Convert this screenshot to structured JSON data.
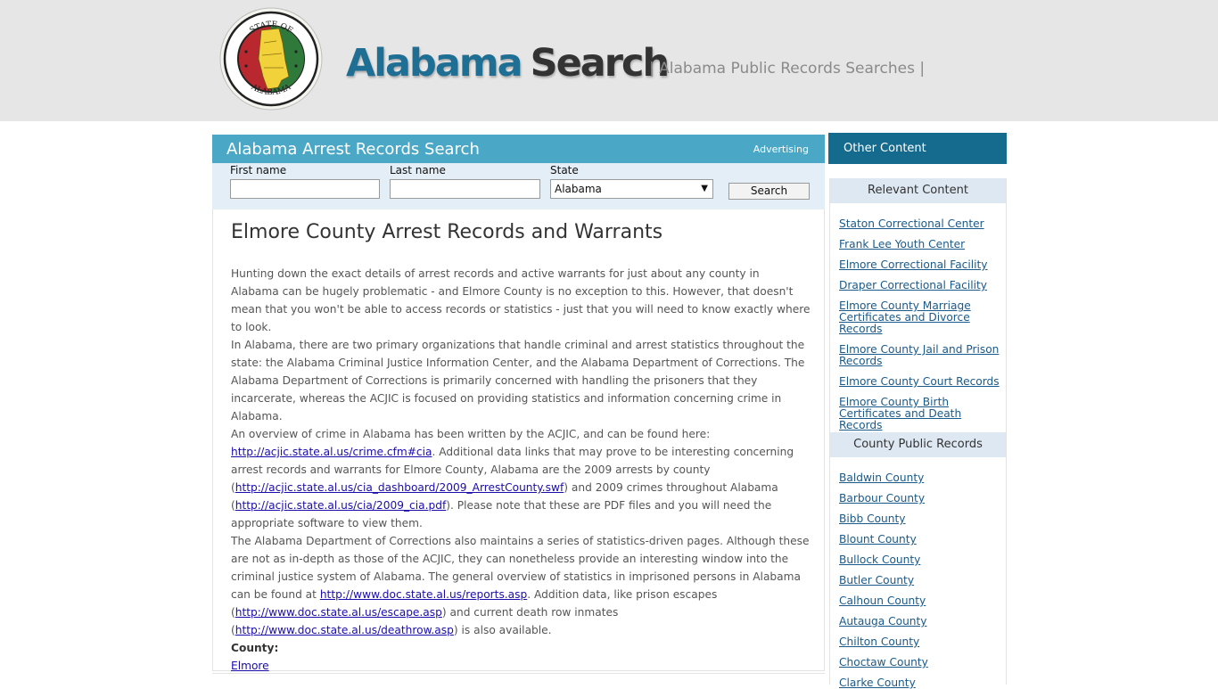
{
  "header": {
    "brand_part1": "Alabama",
    "brand_part2": "Search",
    "tagline": "| Alabama Public Records Searches |",
    "seal_top_text": "STATE OF",
    "seal_bottom_text": "ALABAMA"
  },
  "search": {
    "title": "Alabama Arrest Records Search",
    "advertising": "Advertising",
    "first_name_label": "First name",
    "first_name_value": "",
    "last_name_label": "Last name",
    "last_name_value": "",
    "state_label": "State",
    "state_value": "Alabama",
    "button_label": "Search"
  },
  "article": {
    "title": "Elmore County Arrest Records and Warrants",
    "p1": "Hunting down the exact details of arrest records and active warrants for just about any county in Alabama can be hugely problematic - and Elmore County is no exception to this. However, that doesn't mean that you won't be able to access records or statistics - just that you will need to know exactly where to look.",
    "p2": "In Alabama, there are two primary organizations that handle criminal and arrest statistics throughout the state: the Alabama Criminal Justice Information Center, and the Alabama Department of Corrections. The Alabama Department of Corrections is primarily concerned with handling the prisoners that they incarcerate, whereas the ACJIC is focused on providing statistics and information concerning crime in Alabama.",
    "p3_a": "An overview of crime in Alabama has been written by the ACJIC, and can be found here: ",
    "p3_link1": "http://acjic.state.al.us/crime.cfm#cia",
    "p3_b": ". Additional data links that may prove to be interesting concerning arrest records and warrants for Elmore County, Alabama are the 2009 arrests by county (",
    "p3_link2": "http://acjic.state.al.us/cia_dashboard/2009_ArrestCounty.swf",
    "p3_c": ") and 2009 crimes throughout Alabama (",
    "p3_link3": "http://acjic.state.al.us/cia/2009_cia.pdf",
    "p3_d": "). Please note that these are PDF files and you will need the appropriate software to view them.",
    "p4_a": "The Alabama Department of Corrections also maintains a series of statistics-driven pages. Although these are not as in-depth as those of the ACJIC, they can nonetheless provide an interesting window into the criminal justice system of Alabama. The general overview of statistics in imprisoned persons in Alabama can be found at ",
    "p4_link1": "http://www.doc.state.al.us/reports.asp",
    "p4_b": ". Addition data, like prison escapes (",
    "p4_link2": "http://www.doc.state.al.us/escape.asp",
    "p4_c": ") and current death row inmates (",
    "p4_link3": "http://www.doc.state.al.us/deathrow.asp",
    "p4_d": ") is also available.",
    "county_label": "County:",
    "county_link": "Elmore"
  },
  "sidebar": {
    "header": "Other Content",
    "relevant_title": "Relevant Content",
    "relevant_items": [
      "Staton Correctional Center",
      "Frank Lee Youth Center",
      "Elmore Correctional Facility",
      "Draper Correctional Facility",
      "Elmore County Marriage Certificates and Divorce Records",
      "Elmore County Jail and Prison Records",
      "Elmore County Court Records",
      "Elmore County Birth Certificates and Death Records"
    ],
    "county_title": "County Public Records",
    "county_items": [
      "Baldwin County",
      "Barbour County",
      "Bibb County",
      "Blount County",
      "Bullock County",
      "Butler County",
      "Calhoun County",
      "Autauga County",
      "Chilton County",
      "Choctaw County",
      "Clarke County"
    ]
  },
  "colors": {
    "header_bg": "#e6e6e6",
    "brand_blue": "#1f6f94",
    "search_bar": "#4aa8c6",
    "sidebar_header": "#156b8e",
    "link": "#1a0dab"
  }
}
